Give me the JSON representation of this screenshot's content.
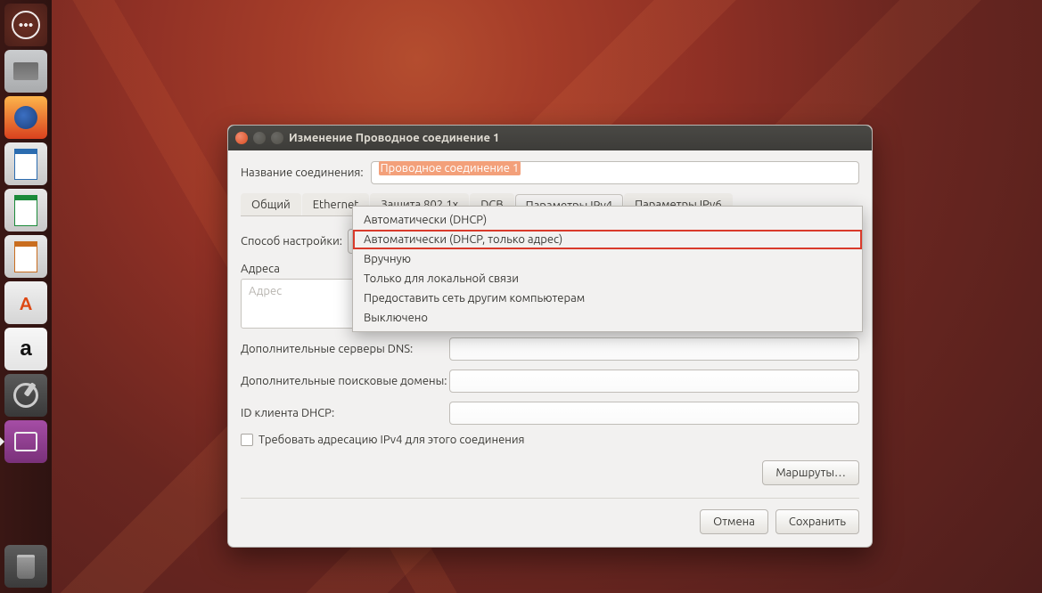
{
  "topbar": {
    "clock": ""
  },
  "launcher": {
    "items": [
      {
        "name": "dash",
        "tip": "Dash"
      },
      {
        "name": "files",
        "tip": "Files"
      },
      {
        "name": "firefox",
        "tip": "Firefox"
      },
      {
        "name": "writer",
        "tip": "LibreOffice Writer"
      },
      {
        "name": "calc",
        "tip": "LibreOffice Calc"
      },
      {
        "name": "impress",
        "tip": "LibreOffice Impress"
      },
      {
        "name": "software",
        "tip": "Ubuntu Software"
      },
      {
        "name": "amazon",
        "tip": "Amazon"
      },
      {
        "name": "settings",
        "tip": "System Settings"
      },
      {
        "name": "network",
        "tip": "Network",
        "active": true
      }
    ]
  },
  "window": {
    "title": "Изменение Проводное соединение 1",
    "name_label": "Название соединения:",
    "name_value": "Проводное соединение 1",
    "tabs": [
      "Общий",
      "Ethernet",
      "Защита 802.1x",
      "DCB",
      "Параметры IPv4",
      "Параметры IPv6"
    ],
    "active_tab": "Параметры IPv4",
    "ipv4": {
      "method_label": "Способ настройки:",
      "method_selected": "Автоматически (DHCP)",
      "method_options": [
        "Автоматически (DHCP)",
        "Автоматически (DHCP, только адрес)",
        "Вручную",
        "Только для локальной связи",
        "Предоставить сеть другим компьютерам",
        "Выключено"
      ],
      "highlight_index": 1,
      "addresses_label": "Адреса",
      "addresses_placeholder": "Адрес",
      "dns_label": "Дополнительные серверы DNS:",
      "search_label": "Дополнительные поисковые домены:",
      "dhcp_id_label": "ID клиента DHCP:",
      "require_checkbox": "Требовать адресацию IPv4 для этого соединения",
      "routes_button": "Маршруты…"
    },
    "footer": {
      "cancel": "Отмена",
      "save": "Сохранить"
    }
  }
}
